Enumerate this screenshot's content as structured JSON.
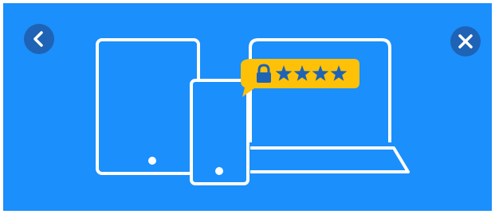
{
  "banner": {
    "background_color": "#1b8ffb",
    "line_color": "#ffffff"
  },
  "navigation": {
    "back_icon": "chevron-left-icon",
    "close_icon": "close-icon",
    "button_color": "#1e63b5"
  },
  "illustration": {
    "devices": [
      "tablet",
      "smartphone",
      "laptop"
    ],
    "password_bubble": {
      "icon": "lock-icon",
      "masked_text": "****",
      "color": "#ffc107",
      "text_color": "#1e63b5"
    }
  }
}
